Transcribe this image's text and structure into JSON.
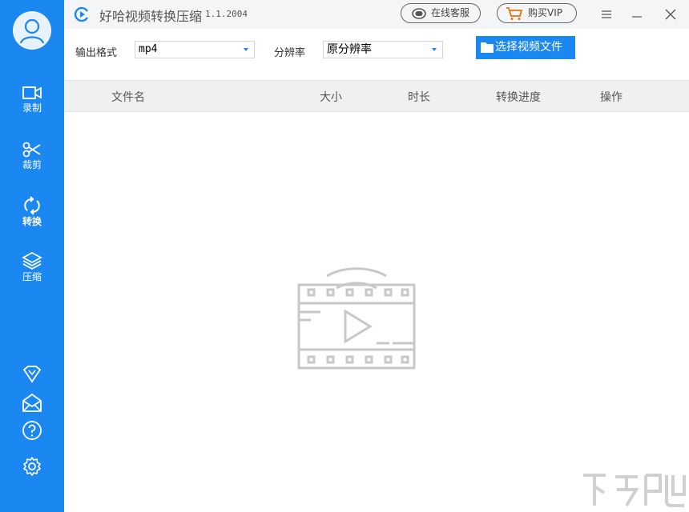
{
  "app": {
    "title": "好哈视频转换压缩",
    "version": "1.1.2004"
  },
  "titlebar": {
    "service_label": "在线客服",
    "vip_label": "购买VIP",
    "menu_icon": "menu-icon",
    "minimize_icon": "minimize-icon",
    "close_icon": "close-icon"
  },
  "sidebar": {
    "items": [
      {
        "label": "录制",
        "icon": "video-camera-icon",
        "active": false
      },
      {
        "label": "裁剪",
        "icon": "scissors-icon",
        "active": false
      },
      {
        "label": "转换",
        "icon": "convert-icon",
        "active": true
      },
      {
        "label": "压缩",
        "icon": "layers-icon",
        "active": false
      }
    ],
    "bottom_icons": [
      "vip-diamond-icon",
      "mail-icon",
      "help-icon",
      "settings-icon"
    ]
  },
  "toolbar": {
    "format_label": "输出格式",
    "format_value": "mp4",
    "resolution_label": "分辨率",
    "resolution_value": "原分辨率",
    "choose_button": "选择视频文件"
  },
  "table": {
    "columns": [
      "文件名",
      "大小",
      "时长",
      "转换进度",
      "操作"
    ],
    "rows": []
  },
  "colors": {
    "accent": "#1b87f0",
    "titlebar_bg": "#f4f5f6",
    "header_bg": "#eef0f2",
    "illustration": "#c8c8c8"
  }
}
